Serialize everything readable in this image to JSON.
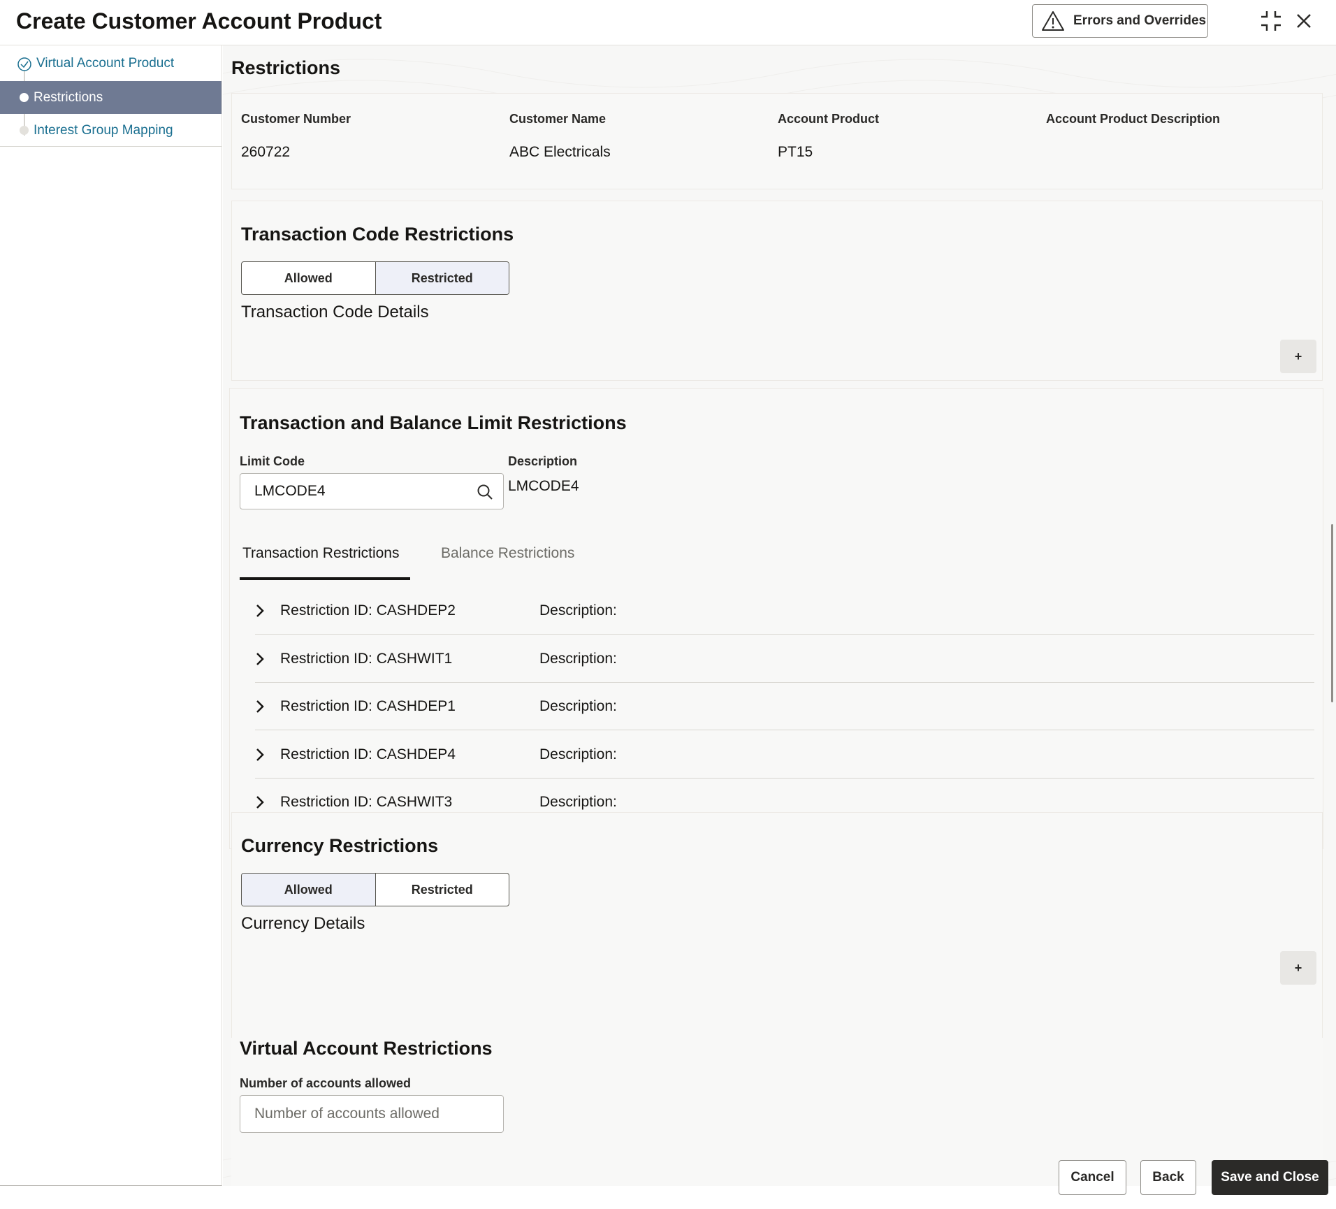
{
  "header": {
    "title": "Create Customer Account Product",
    "errors_label": "Errors and Overrides"
  },
  "sidebar": {
    "items": [
      {
        "label": "Virtual Account Product",
        "state": "completed"
      },
      {
        "label": "Restrictions",
        "state": "active"
      },
      {
        "label": "Interest Group Mapping",
        "state": "pending"
      }
    ]
  },
  "page": {
    "title": "Restrictions",
    "summary": {
      "fields": [
        {
          "label": "Customer Number",
          "value": "260722"
        },
        {
          "label": "Customer Name",
          "value": "ABC Electricals"
        },
        {
          "label": "Account Product",
          "value": "PT15"
        },
        {
          "label": "Account Product Description",
          "value": ""
        }
      ]
    }
  },
  "txn_code": {
    "title": "Transaction Code Restrictions",
    "options": [
      "Allowed",
      "Restricted"
    ],
    "selected": "Restricted",
    "details_label": "Transaction Code Details",
    "add_label": "+"
  },
  "limits": {
    "title": "Transaction and Balance Limit Restrictions",
    "limit_code_label": "Limit Code",
    "limit_code_value": "LMCODE4",
    "description_label": "Description",
    "description_value": "LMCODE4",
    "tabs": [
      {
        "label": "Transaction Restrictions",
        "active": true
      },
      {
        "label": "Balance Restrictions",
        "active": false
      }
    ],
    "rows": [
      {
        "id": "Restriction ID: CASHDEP2",
        "desc": "Description:"
      },
      {
        "id": "Restriction ID: CASHWIT1",
        "desc": "Description:"
      },
      {
        "id": "Restriction ID: CASHDEP1",
        "desc": "Description:"
      },
      {
        "id": "Restriction ID: CASHDEP4",
        "desc": "Description:"
      },
      {
        "id": "Restriction ID: CASHWIT3",
        "desc": "Description:"
      }
    ]
  },
  "currency": {
    "title": "Currency Restrictions",
    "options": [
      "Allowed",
      "Restricted"
    ],
    "selected": "Allowed",
    "details_label": "Currency Details",
    "add_label": "+"
  },
  "virtual": {
    "title": "Virtual Account Restrictions",
    "field_label": "Number of accounts allowed",
    "placeholder": "Number of accounts allowed"
  },
  "footer": {
    "cancel": "Cancel",
    "back": "Back",
    "save_close": "Save and Close"
  },
  "colors": {
    "active_nav": "#6f7a93",
    "link": "#1a6f90",
    "primary_button": "#2b2a28"
  }
}
